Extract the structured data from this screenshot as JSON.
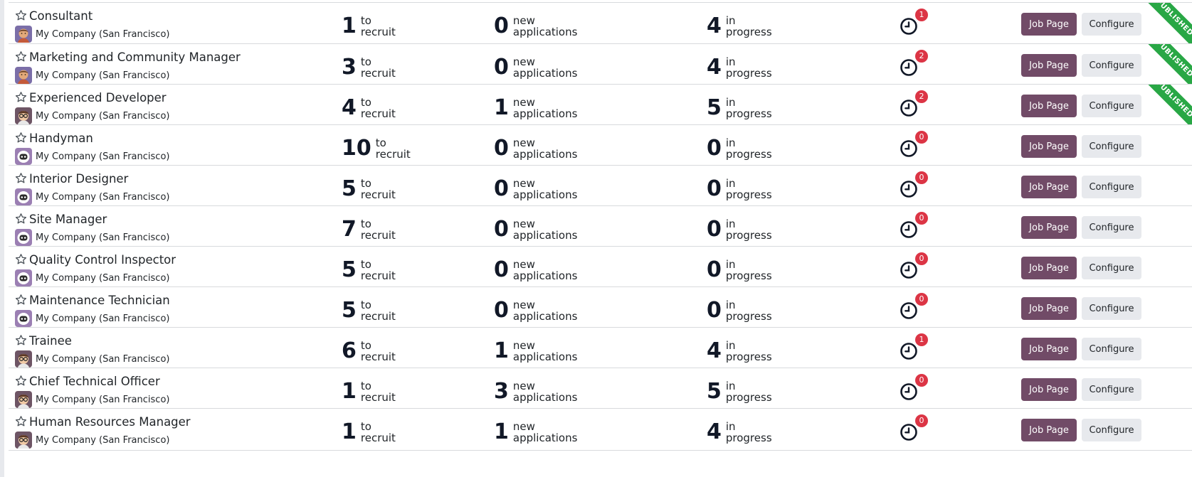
{
  "company_name": "My Company (San Francisco)",
  "labels": {
    "to_recruit": [
      "to",
      "recruit"
    ],
    "new_applications": [
      "new",
      "applications"
    ],
    "in_progress": [
      "in",
      "progress"
    ],
    "job_page_button": "Job Page",
    "configure_button": "Configure",
    "published_ribbon": "PUBLISHED"
  },
  "colors": {
    "primary": "#714b67",
    "secondary": "#e7e9ed",
    "badge": "#dc3545",
    "published": "#28a745"
  },
  "jobs": [
    {
      "title": "Consultant",
      "to_recruit": 1,
      "new_applications": 0,
      "in_progress": 4,
      "activities": 1,
      "published": true,
      "avatar": "person-avatar"
    },
    {
      "title": "Marketing and Community Manager",
      "to_recruit": 3,
      "new_applications": 0,
      "in_progress": 4,
      "activities": 2,
      "published": true,
      "avatar": "person-avatar"
    },
    {
      "title": "Experienced Developer",
      "to_recruit": 4,
      "new_applications": 1,
      "in_progress": 5,
      "activities": 2,
      "published": true,
      "avatar": "glasses-avatar"
    },
    {
      "title": "Handyman",
      "to_recruit": 10,
      "new_applications": 0,
      "in_progress": 0,
      "activities": 0,
      "published": false,
      "avatar": "bot-avatar"
    },
    {
      "title": "Interior Designer",
      "to_recruit": 5,
      "new_applications": 0,
      "in_progress": 0,
      "activities": 0,
      "published": false,
      "avatar": "bot-avatar"
    },
    {
      "title": "Site Manager",
      "to_recruit": 7,
      "new_applications": 0,
      "in_progress": 0,
      "activities": 0,
      "published": false,
      "avatar": "bot-avatar"
    },
    {
      "title": "Quality Control Inspector",
      "to_recruit": 5,
      "new_applications": 0,
      "in_progress": 0,
      "activities": 0,
      "published": false,
      "avatar": "bot-avatar"
    },
    {
      "title": "Maintenance Technician",
      "to_recruit": 5,
      "new_applications": 0,
      "in_progress": 0,
      "activities": 0,
      "published": false,
      "avatar": "bot-avatar"
    },
    {
      "title": "Trainee",
      "to_recruit": 6,
      "new_applications": 1,
      "in_progress": 4,
      "activities": 1,
      "published": false,
      "avatar": "glasses-avatar"
    },
    {
      "title": "Chief Technical Officer",
      "to_recruit": 1,
      "new_applications": 3,
      "in_progress": 5,
      "activities": 0,
      "published": false,
      "avatar": "glasses-avatar"
    },
    {
      "title": "Human Resources Manager",
      "to_recruit": 1,
      "new_applications": 1,
      "in_progress": 4,
      "activities": 0,
      "published": false,
      "avatar": "glasses-avatar"
    }
  ]
}
